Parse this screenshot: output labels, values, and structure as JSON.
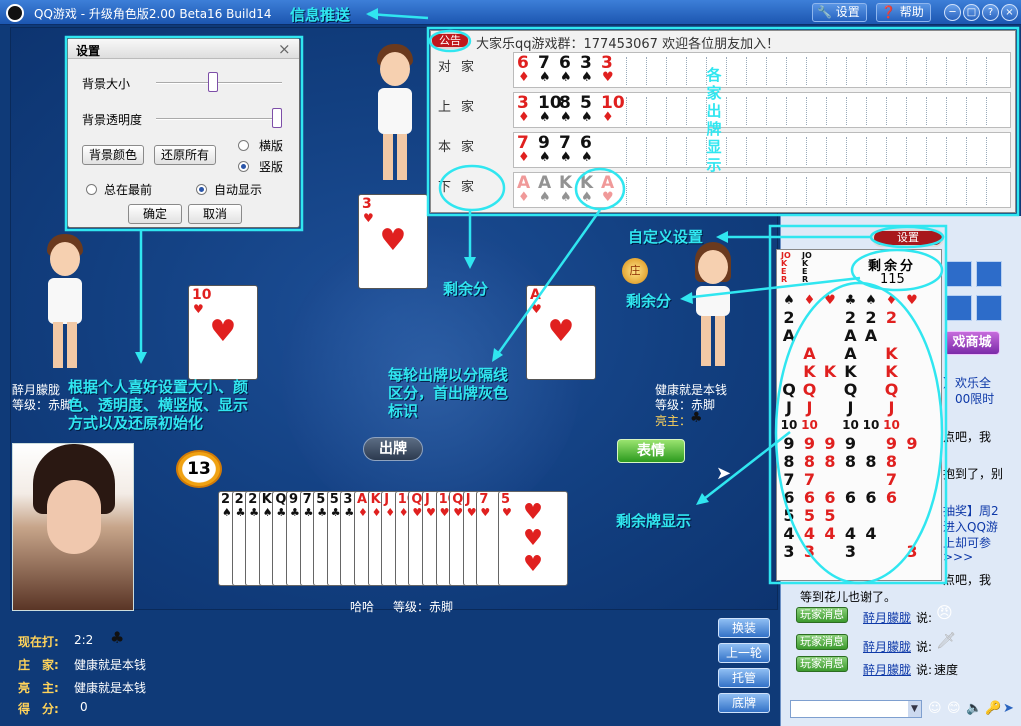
{
  "window": {
    "title": "QQ游戏 - 升级角色版2.00 Beta16 Build14",
    "settings_label": "设置",
    "help_label": "帮助",
    "min_glyph": "─",
    "max_glyph": "□",
    "help_glyph": "?",
    "close_glyph": "×"
  },
  "settings_dialog": {
    "title": "设置",
    "close_glyph": "×",
    "bg_size_label": "背景大小",
    "bg_opacity_label": "背景透明度",
    "bg_size_level": 0.45,
    "bg_opacity_level": 1.0,
    "bg_color_button": "背景颜色",
    "restore_all_button": "还原所有",
    "horizontal_label": "横版",
    "vertical_label": "竖版",
    "orientation": "vertical",
    "always_on_top_label": "总在最前",
    "auto_show_label": "自动显示",
    "auto_show": true,
    "ok_button": "确定",
    "cancel_button": "取消"
  },
  "notice": {
    "badge": "公告",
    "text": "大家乐qq游戏群：177453067 欢迎各位朋友加入！"
  },
  "played_rows": [
    {
      "seat": "对家",
      "cards": [
        {
          "r": "6",
          "s": "♦",
          "c": "red"
        },
        {
          "r": "7",
          "s": "♠",
          "c": "blk"
        },
        {
          "r": "6",
          "s": "♠",
          "c": "blk"
        },
        {
          "r": "3",
          "s": "♠",
          "c": "blk"
        },
        {
          "r": "3",
          "s": "♥",
          "c": "red"
        }
      ]
    },
    {
      "seat": "上家",
      "cards": [
        {
          "r": "3",
          "s": "♦",
          "c": "red"
        },
        {
          "r": "10",
          "s": "♠",
          "c": "blk"
        },
        {
          "r": "8",
          "s": "♠",
          "c": "blk"
        },
        {
          "r": "5",
          "s": "♠",
          "c": "blk"
        },
        {
          "r": "10",
          "s": "♦",
          "c": "red"
        }
      ]
    },
    {
      "seat": "本家",
      "cards": [
        {
          "r": "7",
          "s": "♦",
          "c": "red"
        },
        {
          "r": "9",
          "s": "♠",
          "c": "blk"
        },
        {
          "r": "7",
          "s": "♠",
          "c": "blk"
        },
        {
          "r": "6",
          "s": "♠",
          "c": "blk"
        }
      ]
    },
    {
      "seat": "下家",
      "cards": [
        {
          "r": "A",
          "s": "♦",
          "c": "red"
        },
        {
          "r": "A",
          "s": "♠",
          "c": "blk"
        },
        {
          "r": "K",
          "s": "♠",
          "c": "blk"
        },
        {
          "r": "K",
          "s": "♠",
          "c": "blk"
        },
        {
          "r": "A",
          "s": "♥",
          "c": "red"
        }
      ],
      "faded": true
    }
  ],
  "players": {
    "top_name": "",
    "left_name": "醉月朦胧",
    "left_level": "等级：赤脚",
    "right_name": "健康就是本钱",
    "right_level": "等级：赤脚",
    "right_dealer": "亮主：",
    "self_name": "哈哈",
    "self_level": "等级：赤脚"
  },
  "table_cards": {
    "top": {
      "r": "3",
      "s": "♥",
      "c": "red"
    },
    "left": {
      "r": "10",
      "s": "♥",
      "c": "red"
    },
    "right": {
      "r": "A",
      "s": "♥",
      "c": "red"
    },
    "self": {
      "r": "5",
      "s": "♥",
      "c": "red"
    }
  },
  "hand": [
    {
      "r": "2",
      "s": "♠",
      "c": "blk"
    },
    {
      "r": "2",
      "s": "♣",
      "c": "blk"
    },
    {
      "r": "2",
      "s": "♣",
      "c": "blk"
    },
    {
      "r": "K",
      "s": "♠",
      "c": "blk"
    },
    {
      "r": "Q",
      "s": "♣",
      "c": "blk"
    },
    {
      "r": "9",
      "s": "♣",
      "c": "blk"
    },
    {
      "r": "7",
      "s": "♣",
      "c": "blk"
    },
    {
      "r": "5",
      "s": "♣",
      "c": "blk"
    },
    {
      "r": "5",
      "s": "♣",
      "c": "blk"
    },
    {
      "r": "3",
      "s": "♣",
      "c": "blk"
    },
    {
      "r": "A",
      "s": "♦",
      "c": "red"
    },
    {
      "r": "K",
      "s": "♦",
      "c": "red"
    },
    {
      "r": "J",
      "s": "♦",
      "c": "red"
    },
    {
      "r": "10",
      "s": "♦",
      "c": "red"
    },
    {
      "r": "Q",
      "s": "♥",
      "c": "red"
    },
    {
      "r": "J",
      "s": "♥",
      "c": "red"
    },
    {
      "r": "10",
      "s": "♥",
      "c": "red"
    },
    {
      "r": "Q",
      "s": "♥",
      "c": "red"
    },
    {
      "r": "J",
      "s": "♥",
      "c": "red"
    },
    {
      "r": "7",
      "s": "♥",
      "c": "red"
    },
    {
      "r": "5",
      "s": "♥",
      "c": "red"
    }
  ],
  "buttons": {
    "play": "出牌",
    "emotion": "表情",
    "timer": "13",
    "swap": "换装",
    "last_round": "上一轮",
    "auto": "托管",
    "bottom": "底牌"
  },
  "status": {
    "playing_label": "现在打:",
    "playing_value": "2:2",
    "dealer_label": "庄　家:",
    "dealer_value": "健康就是本钱",
    "trump_label": "亮　主:",
    "trump_value": "健康就是本钱",
    "score_label": "得　分:",
    "score_value": "0"
  },
  "remain_panel": {
    "settings_badge": "设置",
    "head_label": "剩余分",
    "head_value": "115",
    "jokers": [
      "JOKER",
      "JOKER"
    ],
    "columns": [
      {
        "suit": "♠",
        "c": "blk",
        "cards": [
          "2",
          "A",
          "",
          "",
          "Q",
          "J",
          "10",
          "9",
          "8",
          "7",
          "6",
          "5",
          "4",
          "3"
        ]
      },
      {
        "suit": "♦",
        "c": "red",
        "cards": [
          "",
          "",
          "A",
          "K",
          "Q",
          "J",
          "10",
          "9",
          "8",
          "7",
          "6",
          "5",
          "4",
          "3"
        ]
      },
      {
        "suit": "♥",
        "c": "red",
        "cards": [
          "",
          "",
          "",
          "K",
          "",
          "",
          "",
          "9",
          "8",
          "",
          "6",
          "5",
          "4",
          ""
        ]
      },
      {
        "suit": "♣",
        "c": "blk",
        "cards": [
          "2",
          "A",
          "A",
          "K",
          "Q",
          "J",
          "10",
          "9",
          "8",
          "",
          "6",
          "",
          "4",
          "3"
        ]
      },
      {
        "suit": "♠",
        "c": "blk",
        "cards": [
          "2",
          "A",
          "",
          "",
          "",
          "",
          "10",
          "",
          "8",
          "",
          "6",
          "",
          "4",
          ""
        ]
      },
      {
        "suit": "♦",
        "c": "red",
        "cards": [
          "2",
          "",
          "K",
          "K",
          "Q",
          "J",
          "10",
          "9",
          "8",
          "7",
          "6",
          "",
          "",
          ""
        ]
      },
      {
        "suit": "♥",
        "c": "red",
        "cards": [
          "",
          "",
          "",
          "",
          "",
          "",
          "",
          "9",
          "",
          "",
          "",
          "",
          "",
          "3"
        ]
      }
    ]
  },
  "chat": {
    "mall_label": "戏商城",
    "lines": [
      "】欢乐全",
      "：00限时",
      "点吧，我",
      "抱到了，别",
      "抽奖】周2",
      "进入QQ游",
      "上却可参",
      ">>>",
      "点吧，我"
    ],
    "last_line": "等到花儿也谢了。",
    "messages": [
      {
        "tag": "玩家消息",
        "name": "醉月朦胧",
        "verb": "说:",
        "text": ""
      },
      {
        "tag": "玩家消息",
        "name": "醉月朦胧",
        "verb": "说:",
        "text": ""
      },
      {
        "tag": "玩家消息",
        "name": "醉月朦胧",
        "verb": "说:",
        "text": "速度"
      }
    ]
  },
  "annotations": {
    "push": "信息推送",
    "each_play": "各家出牌显示",
    "custom": "自定义设置",
    "remain_score": "剩余分",
    "remain_score2": "剩余分",
    "settings_desc": "根据个人喜好设置大小、颜色、透明度、横竖版、显示方式以及还原初始化",
    "round_desc": "每轮出牌以分隔线区分，首出牌灰色标识",
    "remain_cards": "剩余牌显示"
  },
  "colors": {
    "annotation": "#30e6f0",
    "table": "#123f80",
    "accent_red": "#c0181c"
  }
}
